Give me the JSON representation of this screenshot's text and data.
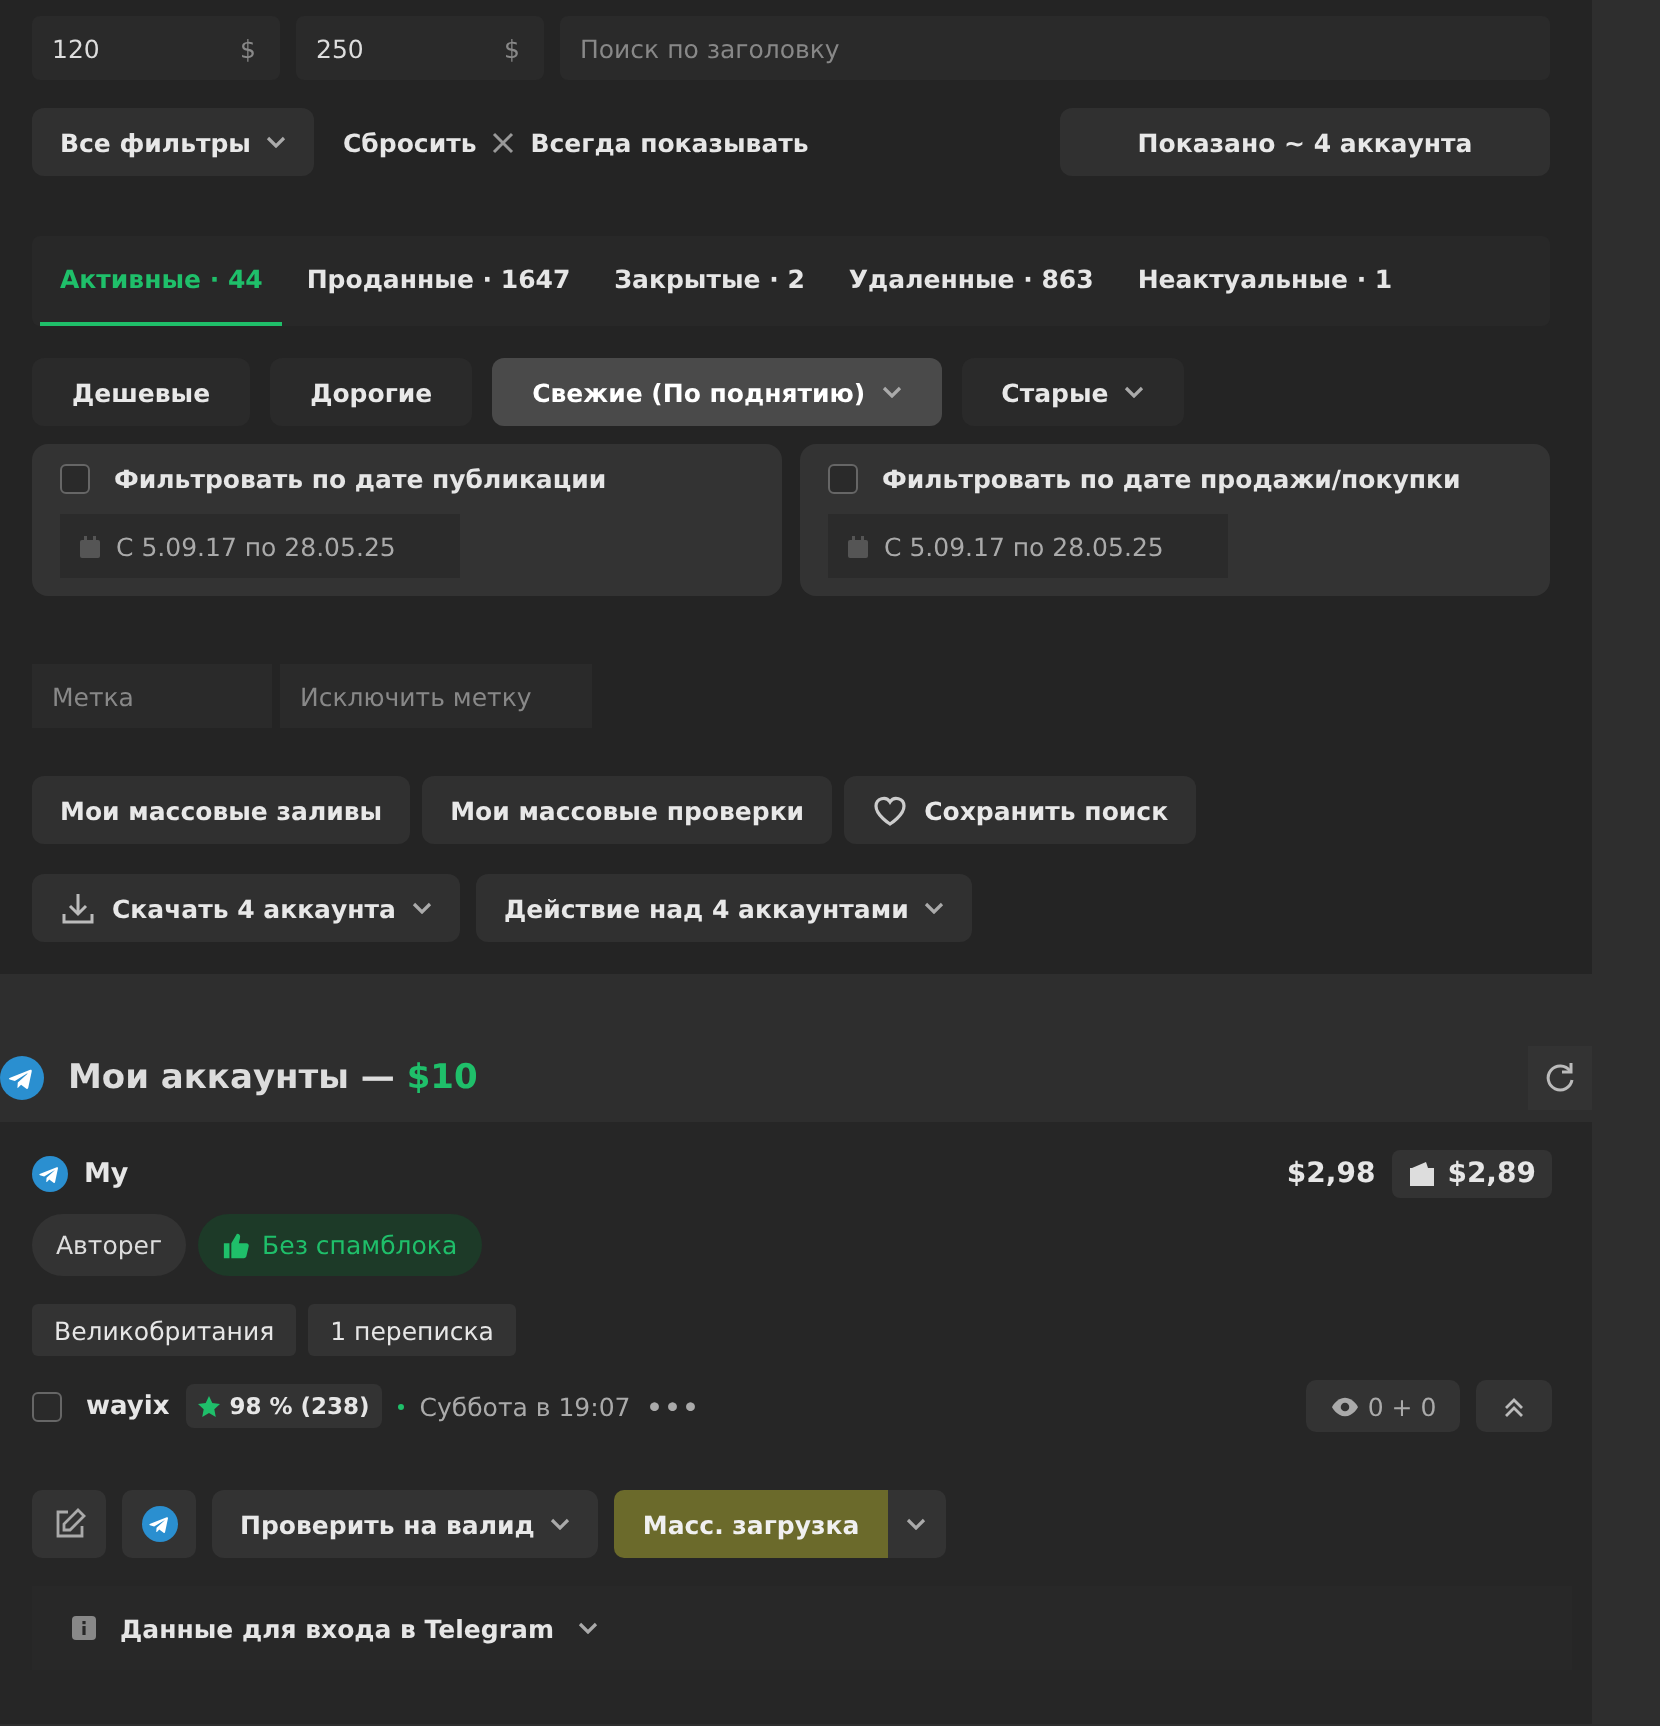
{
  "price_filter": {
    "min": "120",
    "max": "250",
    "currency": "$",
    "search_placeholder": "Поиск по заголовку"
  },
  "filter_bar": {
    "all_filters": "Все фильтры",
    "reset": "Сбросить",
    "always_show": "Всегда показывать",
    "shown": "Показано ~ 4 аккаунта"
  },
  "tabs": [
    {
      "label": "Активные · 44",
      "selected": true
    },
    {
      "label": "Проданные · 1647",
      "selected": false
    },
    {
      "label": "Закрытые · 2",
      "selected": false
    },
    {
      "label": "Удаленные · 863",
      "selected": false
    },
    {
      "label": "Неактуальные · 1",
      "selected": false
    }
  ],
  "sort_options": [
    {
      "label": "Дешевые",
      "selected": false,
      "dropdown": false
    },
    {
      "label": "Дорогие",
      "selected": false,
      "dropdown": false
    },
    {
      "label": "Свежие (По поднятию)",
      "selected": true,
      "dropdown": true
    },
    {
      "label": "Старые",
      "selected": false,
      "dropdown": true
    }
  ],
  "date_filters": [
    {
      "label": "Фильтровать по дате публикации",
      "checked": false,
      "range": "С 5.09.17 по 28.05.25"
    },
    {
      "label": "Фильтровать по дате продажи/покупки",
      "checked": false,
      "range": "С 5.09.17 по 28.05.25"
    }
  ],
  "tag_fields": [
    {
      "placeholder": "Метка"
    },
    {
      "placeholder": "Исключить метку"
    }
  ],
  "action_rows": [
    [
      {
        "label": "Мои массовые заливы",
        "kind": "plain"
      },
      {
        "label": "Мои массовые проверки",
        "kind": "plain"
      },
      {
        "label": "Сохранить поиск",
        "kind": "heart"
      }
    ],
    [
      {
        "label": "Скачать 4 аккаунта",
        "kind": "download"
      },
      {
        "label": "Действие над 4 аккаунтами",
        "kind": "dropdown"
      }
    ]
  ],
  "accounts_section": {
    "title": "Мои аккаунты —",
    "total": "$10"
  },
  "account": {
    "title": "My",
    "price": "$2,98",
    "wallet_price": "$2,89",
    "badges": [
      {
        "label": "Авторег",
        "kind": "plain"
      },
      {
        "label": "Без спамблока",
        "kind": "good"
      }
    ],
    "tags": [
      "Великобритания",
      "1 переписка"
    ],
    "seller": {
      "checked": false,
      "name": "wayix",
      "rating": "98 % (238)",
      "online": true,
      "last_seen": "Суббота в 19:07",
      "more": "•••"
    },
    "views": "0 + 0",
    "actions": {
      "check": "Проверить на валид",
      "mass_upload": "Масс. загрузка"
    },
    "login_info": "Данные для входа в Telegram"
  }
}
